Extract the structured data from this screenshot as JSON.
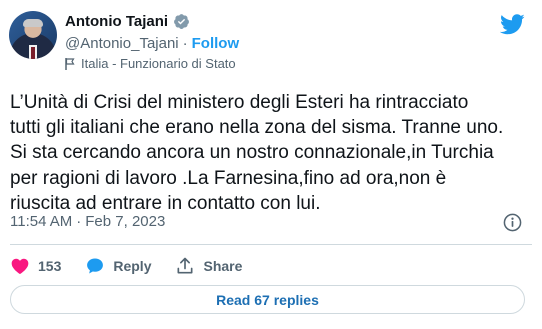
{
  "author": {
    "display_name": "Antonio Tajani",
    "handle": "@Antonio_Tajani",
    "separator": "·",
    "follow_label": "Follow",
    "label": "Italia - Funzionario di Stato"
  },
  "tweet": {
    "text": "L’Unità di Crisi del ministero degli Esteri ha rintracciato\ntutti gli italiani che erano nella zona del sisma. Tranne uno.\nSi sta cercando ancora un nostro connazionale,in Turchia\nper ragioni di lavoro .La Farnesina,fino ad ora,non è\nriuscita ad entrare in contatto con lui.",
    "time": "11:54 AM",
    "separator": "·",
    "date": "Feb 7, 2023"
  },
  "actions": {
    "like_count": "153",
    "reply_label": "Reply",
    "share_label": "Share"
  },
  "read_replies_label": "Read 67 replies",
  "colors": {
    "accent": "#1d9bf0",
    "like": "#f91880"
  },
  "icons": [
    "verified-badge-icon",
    "twitter-bird-icon",
    "flag-icon",
    "info-icon",
    "heart-icon",
    "reply-bubble-icon",
    "share-icon"
  ]
}
